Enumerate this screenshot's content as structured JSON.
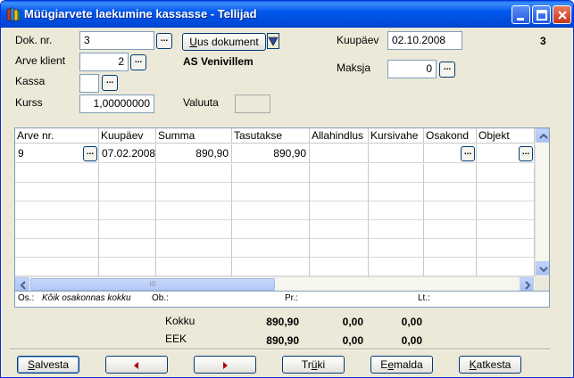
{
  "window": {
    "title": "Müügiarvete laekumine kassasse - Tellijad",
    "document_number_badge": "3"
  },
  "header": {
    "dok_nr_label": "Dok. nr.",
    "dok_nr_value": "3",
    "new_doc_label_prefix": "U",
    "new_doc_label_rest": "us dokument",
    "arve_klient_label": "Arve klient",
    "arve_klient_value": "2",
    "client_name": "AS Venivillem",
    "kassa_label": "Kassa",
    "kassa_value": "",
    "kurss_label": "Kurss",
    "kurss_value": "1,00000000",
    "valuuta_label": "Valuuta",
    "valuuta_value": "",
    "kuupaev_label": "Kuupäev",
    "kuupaev_value": "02.10.2008",
    "maksja_label": "Maksja",
    "maksja_value": "0",
    "browse_glyph": "..."
  },
  "grid": {
    "columns": [
      "Arve nr.",
      "Kuupäev",
      "Summa",
      "Tasutakse",
      "Allahindlus",
      "Kursivahe",
      "Osakond",
      "Objekt"
    ],
    "rows": [
      {
        "arve_nr": "9",
        "kuupaev": "07.02.2008",
        "summa": "890,90",
        "tasutakse": "890,90",
        "allahindlus": "",
        "kursivahe": "",
        "osakond": "",
        "objekt": ""
      }
    ],
    "empty_rows": 6,
    "scroll_thumb_glyph": "III"
  },
  "infobar": {
    "os_label": "Os.:",
    "os_value": "Kõik osakonnas kokku",
    "ob_label": "Ob.:",
    "pr_label": "Pr.:",
    "lt_label": "Lt.:"
  },
  "totals": {
    "kokku_label": "Kokku",
    "kokku_values": [
      "890,90",
      "0,00",
      "0,00"
    ],
    "eek_label": "EEK",
    "eek_values": [
      "890,90",
      "0,00",
      "0,00"
    ]
  },
  "buttons": {
    "save_u": "S",
    "save_rest": "alvesta",
    "print_pre": "Tr",
    "print_u": "ü",
    "print_rest": "ki",
    "remove_pre": "E",
    "remove_u": "e",
    "remove_rest": "malda",
    "cancel_u": "K",
    "cancel_rest": "atkesta"
  },
  "colors": {
    "titlebar": "#0058ee",
    "window_bg": "#ece9d8",
    "field_border": "#7f9db9"
  }
}
